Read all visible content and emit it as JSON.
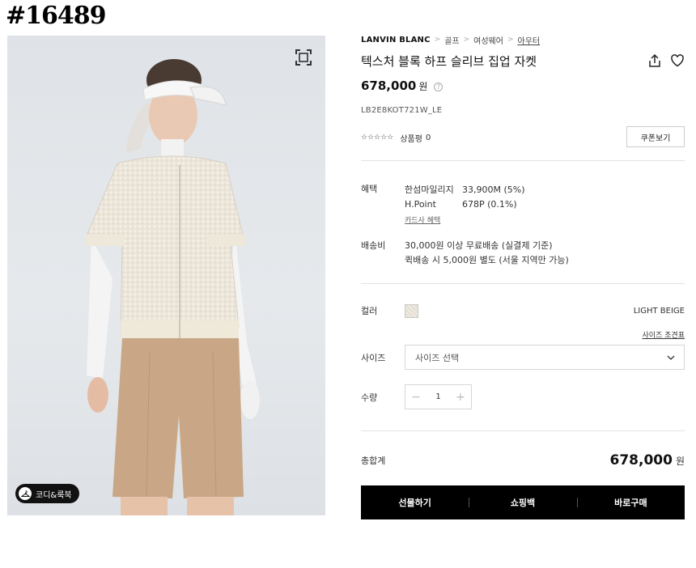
{
  "watermark": {
    "id": "#16489"
  },
  "image": {
    "alt": "",
    "coordi_label": "코디&룩북"
  },
  "breadcrumb": {
    "brand": "LANVIN BLANC",
    "items": [
      "골프",
      "여성웨어",
      "아우터"
    ]
  },
  "product": {
    "title": "텍스처 블록 하프 슬리브 집업 자켓",
    "price": "678,000",
    "currency": "원",
    "sku": "LB2E8KOT721W_LE",
    "stars": "☆☆☆☆☆",
    "rating_label": "상품평",
    "rating_count": "0",
    "coupon_label": "쿠폰보기"
  },
  "benefit": {
    "label": "혜택",
    "rows": [
      {
        "name": "한섬마일리지",
        "value": "33,900M (5%)"
      },
      {
        "name": "H.Point",
        "value": "678P (0.1%)"
      }
    ],
    "card_link": "카드사 혜택"
  },
  "shipping": {
    "label": "배송비",
    "lines": [
      "30,000원 이상 무료배송 (실결제 기준)",
      "퀵배송 시 5,000원 별도 (서울 지역만 가능)"
    ]
  },
  "color": {
    "label": "컬러",
    "selected": "LIGHT BEIGE",
    "swatch": "#efeae2"
  },
  "size": {
    "guide_link": "사이즈 조견표",
    "label": "사이즈",
    "placeholder": "사이즈 선택"
  },
  "quantity": {
    "label": "수량",
    "minus": "−",
    "value": "1",
    "plus": "+"
  },
  "total": {
    "label": "총합계",
    "value": "678,000",
    "currency": "원"
  },
  "actions": {
    "gift": "선물하기",
    "cart": "쇼핑백",
    "buy": "바로구매"
  },
  "colors": {
    "accent": "#000000",
    "divider": "#e2e2e2"
  }
}
